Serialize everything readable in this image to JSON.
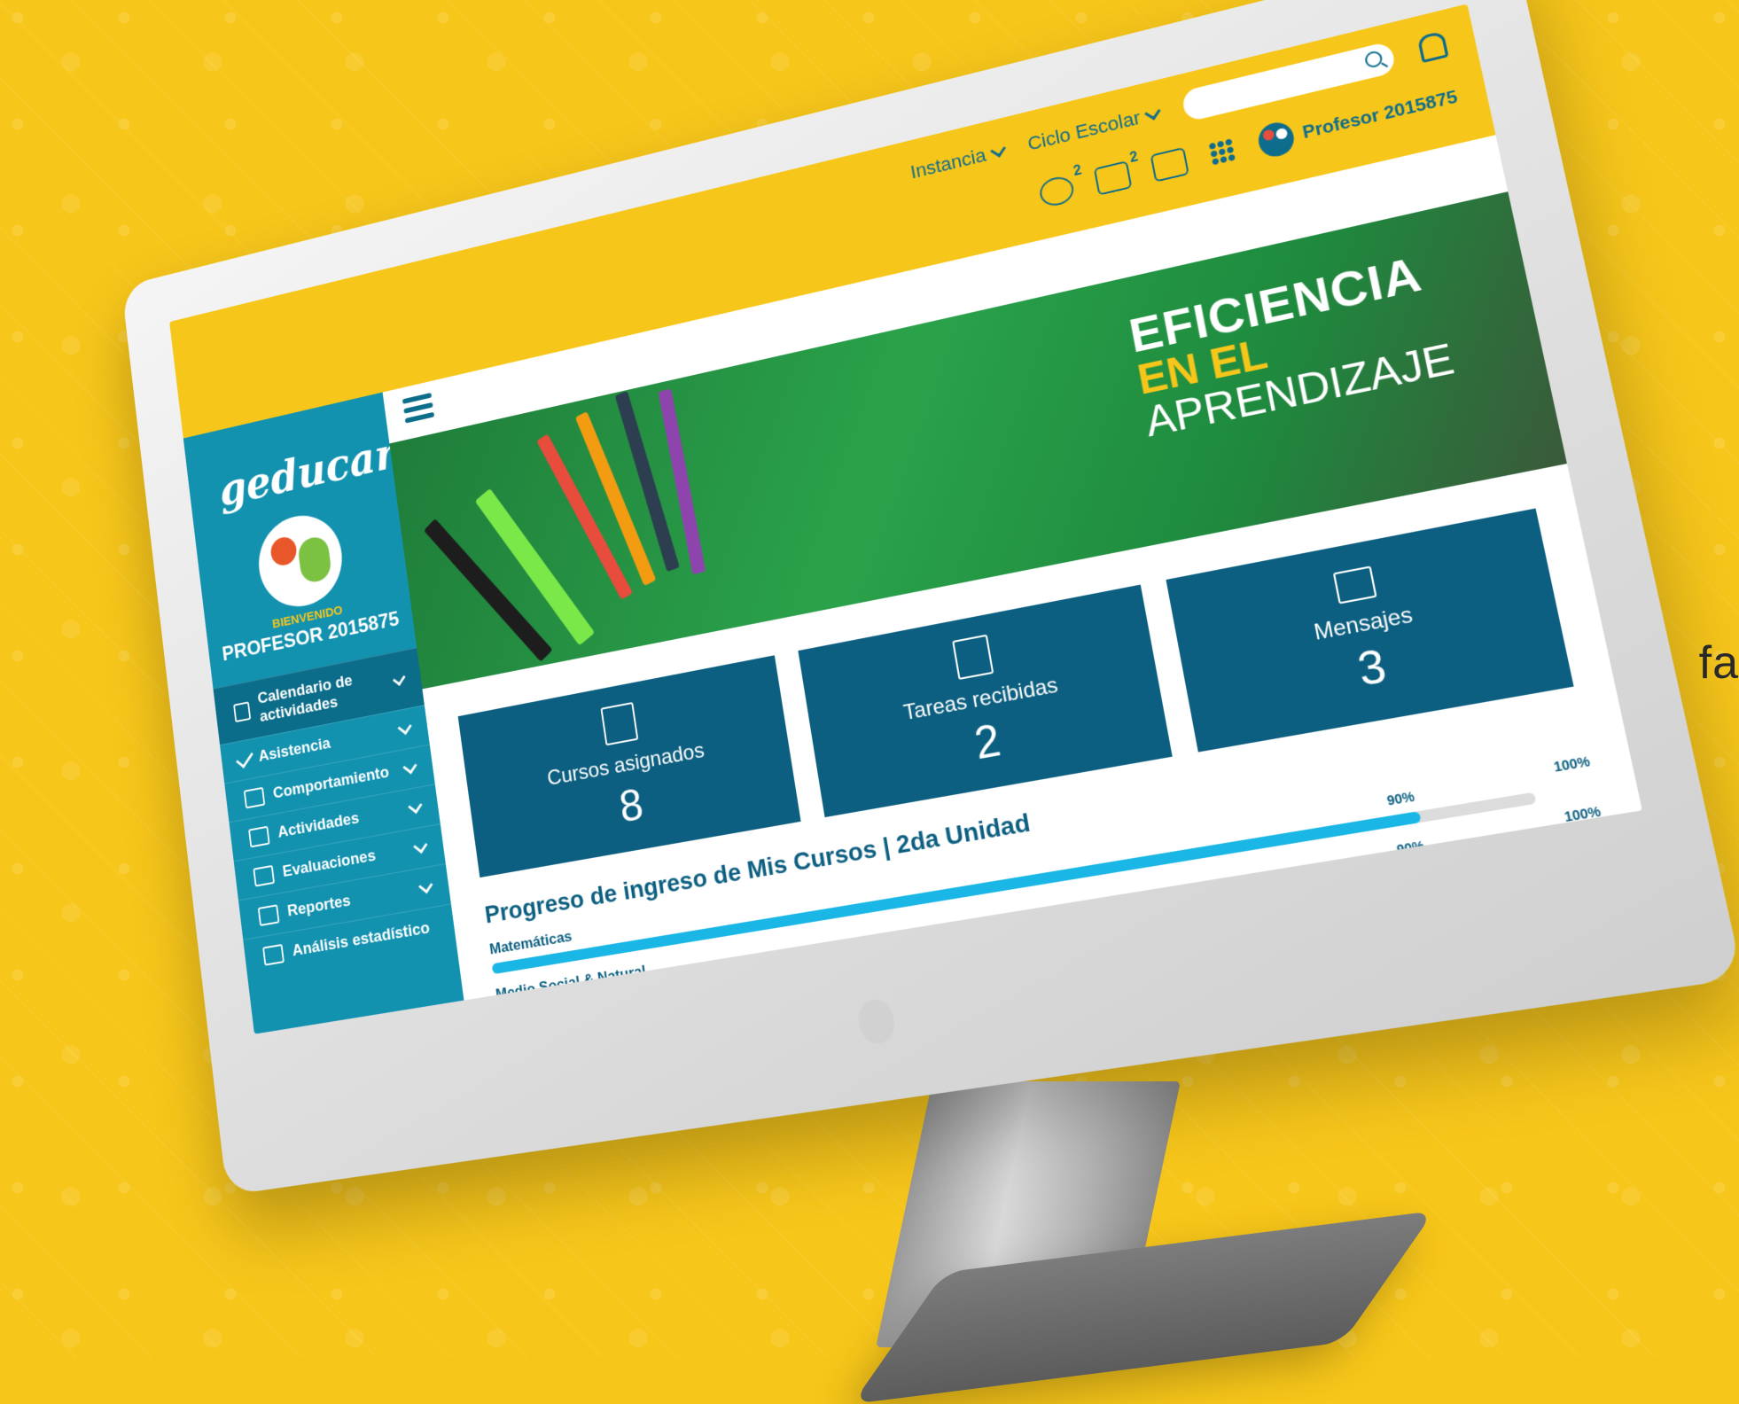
{
  "edge_text": "fa",
  "topbar": {
    "instancia": "Instancia",
    "ciclo": "Ciclo Escolar",
    "search_placeholder": "",
    "chat_badge": "2",
    "mail_badge": "2",
    "profile_name": "Profesor 2015875"
  },
  "sidebar": {
    "logo_main": "geducar",
    "logo_accent": "!!!",
    "welcome": "BIENVENIDO",
    "user": "PROFESOR 2015875",
    "items": [
      {
        "label": "Calendario de actividades",
        "icon": "calendar-icon"
      },
      {
        "label": "Asistencia",
        "icon": "check-icon"
      },
      {
        "label": "Comportamiento",
        "icon": "thumbs-up-icon"
      },
      {
        "label": "Actividades",
        "icon": "activities-icon"
      },
      {
        "label": "Evaluaciones",
        "icon": "list-icon"
      },
      {
        "label": "Reportes",
        "icon": "bar-chart-icon"
      },
      {
        "label": "Análisis estadístico",
        "icon": "line-chart-icon"
      }
    ]
  },
  "banner": {
    "line1": "EFICIENCIA",
    "line2": "EN EL",
    "line3": "APRENDIZAJE"
  },
  "cards": [
    {
      "title": "Cursos asignados",
      "value": "8",
      "icon": "document-icon"
    },
    {
      "title": "Tareas recibidas",
      "value": "2",
      "icon": "checklist-icon"
    },
    {
      "title": "Mensajes",
      "value": "3",
      "icon": "envelope-icon"
    }
  ],
  "progress": {
    "title": "Progreso de ingreso de Mis Cursos | 2da Unidad",
    "rows": [
      {
        "label": "Matemáticas",
        "pct_label": "90%",
        "max_label": "100%",
        "value": 0.9
      },
      {
        "label": "Medio Social & Natural",
        "pct_label": "90%",
        "max_label": "100%",
        "value": 0.9
      }
    ]
  }
}
